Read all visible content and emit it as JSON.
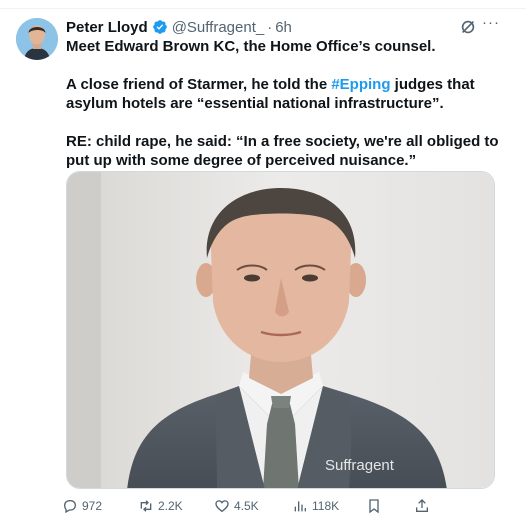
{
  "tweet": {
    "author_name": "Peter Lloyd",
    "author_handle": "@Suffragent_",
    "separator": "·",
    "time": "6h",
    "lines": {
      "p1": "Meet Edward Brown KC, the Home Office’s counsel.",
      "p2_before": "A close friend of Starmer, he told the ",
      "p2_hashtag": "#Epping",
      "p2_after": " judges that asylum hotels are “essential national infrastructure”.",
      "p3": "RE: child rape, he said: “In a free society, we're all obliged to put up with some degree of perceived nuisance.”"
    },
    "media": {
      "watermark": "Suffragent"
    }
  },
  "actions": {
    "replies": "972",
    "reposts": "2.2K",
    "likes": "4.5K",
    "views": "118K"
  },
  "icons": {
    "verified": "verified-badge-icon",
    "grok": "grok-icon",
    "more": "more-icon",
    "reply": "reply-icon",
    "repost": "repost-icon",
    "like": "heart-icon",
    "views": "views-chart-icon",
    "bookmark": "bookmark-icon",
    "share": "share-icon"
  },
  "colors": {
    "accent": "#1d9bf0",
    "text": "#0f1419",
    "muted": "#536471"
  }
}
